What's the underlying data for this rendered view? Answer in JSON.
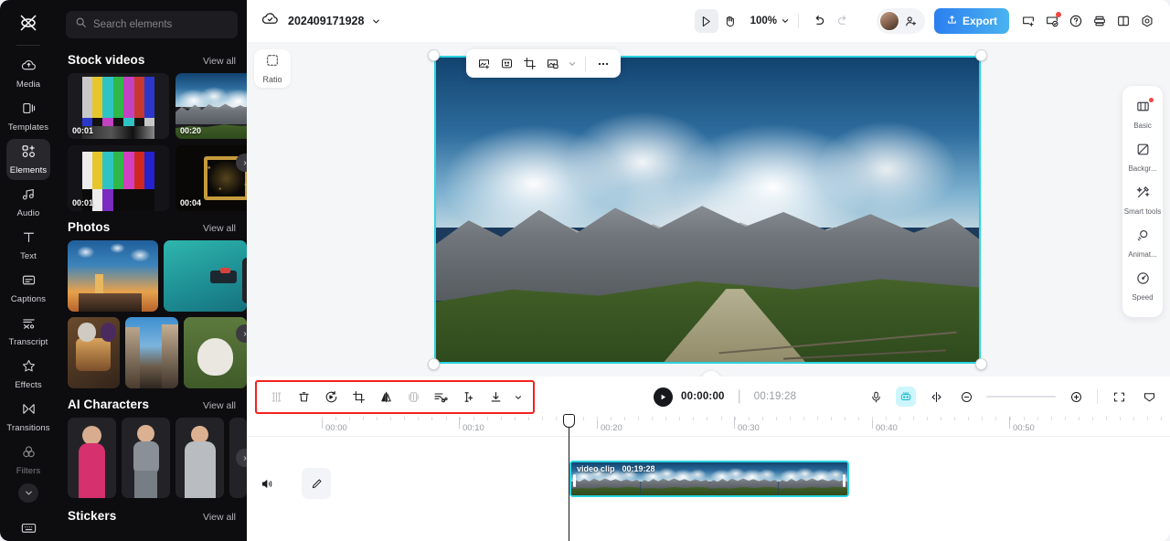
{
  "app": {
    "name": "CapCut",
    "logo_icon": "capcut-logo-icon"
  },
  "left_rail": {
    "items": [
      {
        "label": "Media",
        "icon": "cloud-media-icon",
        "active": false
      },
      {
        "label": "Templates",
        "icon": "templates-icon",
        "active": false
      },
      {
        "label": "Elements",
        "icon": "elements-icon",
        "active": true
      },
      {
        "label": "Audio",
        "icon": "audio-note-icon",
        "active": false
      },
      {
        "label": "Text",
        "icon": "text-t-icon",
        "active": false
      },
      {
        "label": "Captions",
        "icon": "captions-icon",
        "active": false
      },
      {
        "label": "Transcript",
        "icon": "transcript-icon",
        "active": false
      },
      {
        "label": "Effects",
        "icon": "effects-sparkle-icon",
        "active": false
      },
      {
        "label": "Transitions",
        "icon": "transitions-icon",
        "active": false
      },
      {
        "label": "Filters",
        "icon": "filters-circles-icon",
        "active": false
      }
    ],
    "expand_icon": "chevron-down-icon",
    "shortcut_icon": "keyboard-icon"
  },
  "panel": {
    "search": {
      "placeholder": "Search elements",
      "value": "",
      "icon": "search-icon"
    },
    "sections": [
      {
        "title": "Stock videos",
        "view_all": "View all",
        "items": [
          {
            "duration": "00:01",
            "kind": "colorbars"
          },
          {
            "duration": "00:20",
            "kind": "mountain"
          },
          {
            "duration": "00:01",
            "kind": "colorbars2"
          },
          {
            "duration": "00:04",
            "kind": "gold"
          }
        ]
      },
      {
        "title": "Photos",
        "view_all": "View all",
        "items": [
          {
            "kind": "city"
          },
          {
            "kind": "sea"
          },
          {
            "kind": "food"
          },
          {
            "kind": "street"
          },
          {
            "kind": "dog"
          }
        ]
      },
      {
        "title": "AI Characters",
        "view_all": "View all",
        "items": [
          {
            "kind": "woman-pink"
          },
          {
            "kind": "woman-gray"
          },
          {
            "kind": "woman-sweater"
          },
          {
            "kind": "woman-partial"
          }
        ]
      },
      {
        "title": "Stickers",
        "view_all": "View all",
        "items": []
      }
    ],
    "next_arrow_icon": "chevron-right-icon"
  },
  "topbar": {
    "cloud_icon": "cloud-saved-icon",
    "project_name": "202409171928",
    "project_dropdown_icon": "chevron-down-icon",
    "select_tool_icon": "cursor-select-icon",
    "hand_tool_icon": "hand-pan-icon",
    "zoom_level": "100%",
    "zoom_dropdown_icon": "chevron-down-icon",
    "undo_icon": "undo-icon",
    "redo_icon": "redo-icon",
    "avatar_icon": "user-avatar",
    "invite_icon": "add-person-icon",
    "export_label": "Export",
    "export_icon": "upload-icon",
    "export_color": "#2b7ff0",
    "present_icon": "present-screen-icon",
    "privacy_icon": "privacy-shield-icon",
    "help_icon": "help-question-icon",
    "save_icon": "save-disk-icon",
    "layout_icon": "panel-layout-icon",
    "settings_icon": "settings-gear-icon",
    "notification_color": "#f5453f"
  },
  "stage": {
    "ratio_label": "Ratio",
    "ratio_icon": "ratio-dashed-icon",
    "float_toolbar": [
      {
        "icon": "image-add-icon",
        "name": "replace-image"
      },
      {
        "icon": "auto-frame-icon",
        "name": "auto-frame"
      },
      {
        "icon": "crop-icon",
        "name": "crop"
      },
      {
        "icon": "remove-bg-icon",
        "name": "remove-background"
      },
      {
        "icon": "chevron-down-icon",
        "name": "more-options-chevron"
      },
      {
        "icon": "ellipsis-icon",
        "name": "more-menu"
      }
    ],
    "selection_color": "#2ad3e0",
    "rotate_icon": "rotate-handle-icon"
  },
  "right_panel": {
    "items": [
      {
        "label": "Basic",
        "icon": "basic-film-icon",
        "badge": true
      },
      {
        "label": "Backgr...",
        "icon": "background-icon",
        "badge": false
      },
      {
        "label": "Smart tools",
        "icon": "smart-tools-wand-icon",
        "badge": false
      },
      {
        "label": "Animat...",
        "icon": "animation-icon",
        "badge": false
      },
      {
        "label": "Speed",
        "icon": "speed-gauge-icon",
        "badge": false
      }
    ]
  },
  "timeline_toolbar": {
    "tools": [
      {
        "icon": "split-icon",
        "name": "split",
        "disabled": true
      },
      {
        "icon": "delete-trash-icon",
        "name": "delete",
        "disabled": false
      },
      {
        "icon": "reverse-icon",
        "name": "reverse",
        "disabled": false
      },
      {
        "icon": "crop-icon",
        "name": "crop",
        "disabled": false
      },
      {
        "icon": "mirror-flip-icon",
        "name": "mirror",
        "disabled": false
      },
      {
        "icon": "freeze-frame-icon",
        "name": "freeze",
        "disabled": true
      },
      {
        "icon": "cut-scissors-icon",
        "name": "cut",
        "disabled": false
      },
      {
        "icon": "split-marker-icon",
        "name": "split-marker",
        "disabled": false
      },
      {
        "icon": "download-icon",
        "name": "download",
        "disabled": false
      },
      {
        "icon": "chevron-down-icon",
        "name": "download-dropdown",
        "disabled": false
      }
    ],
    "highlight_color": "#f5211c",
    "play_icon": "play-icon",
    "current_time": "00:00:00",
    "total_time": "00:19:28",
    "mic_icon": "microphone-icon",
    "ai_icon": "ai-assistant-icon",
    "ai_color": "#ccf6fb",
    "marker_icon": "marker-icon",
    "zoom_out_icon": "zoom-out-icon",
    "zoom_in_icon": "zoom-in-icon",
    "fit_icon": "fit-screen-icon",
    "crop_view_icon": "crop-view-icon"
  },
  "timeline": {
    "ruler_labels": [
      "00:00",
      "00:10",
      "00:20",
      "00:30",
      "00:40",
      "00:50"
    ],
    "playhead_time": "00:00",
    "track": {
      "mute_icon": "volume-icon",
      "edit_icon": "edit-pencil-icon",
      "clip": {
        "name": "video clip",
        "duration": "00:19:28",
        "selected": true
      }
    }
  }
}
